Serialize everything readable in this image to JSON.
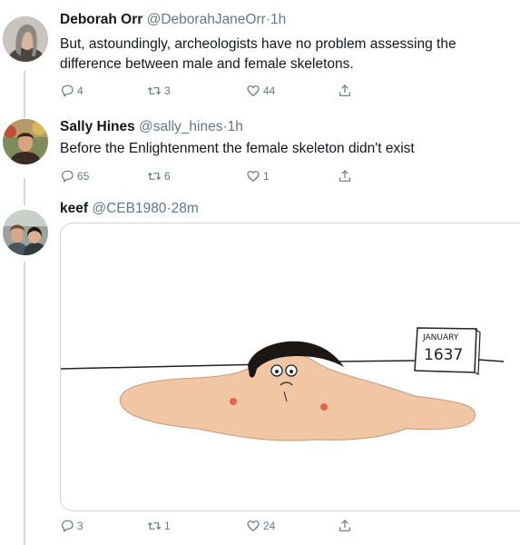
{
  "tweets": [
    {
      "name": "Deborah Orr",
      "handle": "@DeborahJaneOrr",
      "sep": "·",
      "time": "1h",
      "text_lines": [
        "But, astoundingly, archeologists have no problem assessing the",
        "difference between male and female skeletons."
      ],
      "replies": "4",
      "retweets": "3",
      "likes": "44"
    },
    {
      "name": "Sally Hines",
      "handle": "@sally_hines",
      "sep": "·",
      "time": "1h",
      "text_lines": [
        "Before the Enlightenment the female skeleton didn't exist"
      ],
      "replies": "65",
      "retweets": "6",
      "likes": "1"
    },
    {
      "name": "keef",
      "handle": "@CEB1980",
      "sep": "·",
      "time": "28m",
      "replies": "3",
      "retweets": "1",
      "likes": "24",
      "image": {
        "calendar_month": "JANUARY",
        "calendar_year": "1637"
      }
    }
  ],
  "icons": {
    "reply": "reply-icon",
    "retweet": "retweet-icon",
    "like": "heart-icon",
    "share": "share-icon"
  },
  "colors": {
    "text": "#14171a",
    "secondary": "#657786",
    "thread_line": "#cfd9de",
    "blob": "#f0c6a4"
  }
}
